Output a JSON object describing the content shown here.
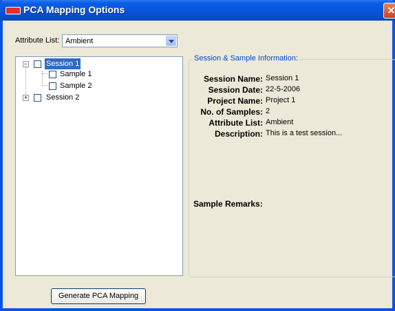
{
  "window": {
    "title": "PCA Mapping Options",
    "close_glyph": "✕"
  },
  "attribute": {
    "label": "Attribute List:",
    "selected": "Ambient"
  },
  "tree": {
    "nodes": [
      {
        "label": "Session 1",
        "expander": "−",
        "selected": true
      },
      {
        "label": "Sample 1"
      },
      {
        "label": "Sample 2"
      },
      {
        "label": "Session 2",
        "expander": "+"
      }
    ]
  },
  "info": {
    "legend": "Session & Sample Information:",
    "rows": [
      {
        "key": "Session Name:",
        "value": "Session 1"
      },
      {
        "key": "Session Date:",
        "value": "22-5-2006"
      },
      {
        "key": "Project Name:",
        "value": "Project 1"
      },
      {
        "key": "No. of Samples:",
        "value": "2"
      },
      {
        "key": "Attribute List:",
        "value": "Ambient"
      },
      {
        "key": "Description:",
        "value": "This is a test session..."
      }
    ],
    "remarks_label": "Sample Remarks:"
  },
  "buttons": {
    "generate_label": "Generate PCA Mapping"
  },
  "colors": {
    "titlebar": "#0852d8",
    "selection": "#316ac5",
    "legend_text": "#0046d5"
  }
}
